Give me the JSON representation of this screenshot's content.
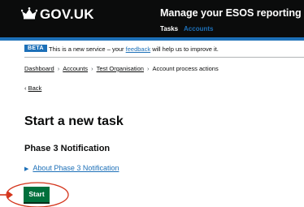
{
  "header": {
    "logo_text": "GOV.UK",
    "service_name": "Manage your ESOS reporting",
    "nav": {
      "tasks": "Tasks",
      "accounts": "Accounts"
    }
  },
  "phase_banner": {
    "tag": "BETA",
    "text_before": "This is a new service – your",
    "link": "feedback",
    "text_after": "will help us to improve it."
  },
  "breadcrumb": [
    "Dashboard",
    "Accounts",
    "Test Organisation",
    "Account process actions"
  ],
  "back_link": "Back",
  "page_title": "Start a new task",
  "section_title": "Phase 3 Notification",
  "details_summary": "About Phase 3 Notification",
  "start_button": "Start",
  "colors": {
    "header_bg": "#0b0c0c",
    "brand_blue": "#1d70b8",
    "button_green": "#00703c",
    "annotation_red": "#d4351c"
  },
  "icons": {
    "logo": "crown-icon",
    "details": "triangle-right-icon",
    "annotation": "red-arrow-and-circle"
  }
}
